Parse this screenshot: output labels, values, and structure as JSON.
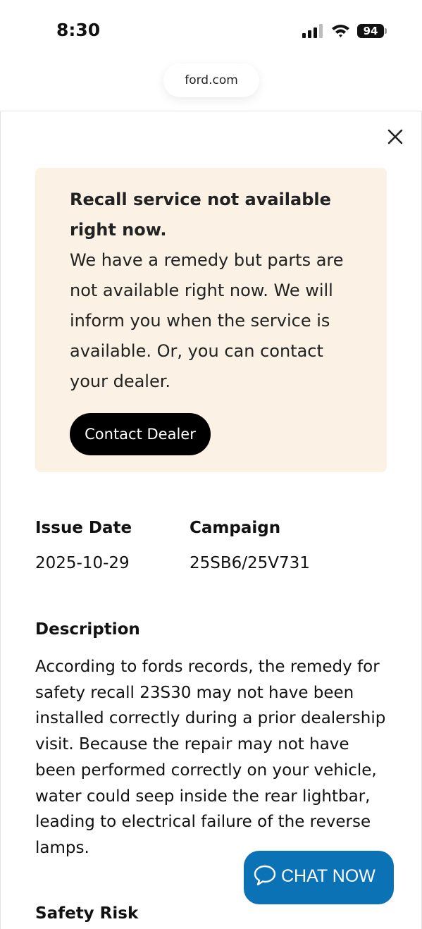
{
  "status_bar": {
    "time": "8:30",
    "battery": "94"
  },
  "browser": {
    "url": "ford.com"
  },
  "alert": {
    "title": "Recall service not available right now.",
    "body": "We have a remedy but parts are not available right now. We will inform you when the service is available. Or, you can contact your dealer.",
    "button_label": "Contact Dealer",
    "background_color": "#fbf1e4"
  },
  "details": {
    "issue_date_label": "Issue Date",
    "issue_date_value": "2025-10-29",
    "campaign_label": "Campaign",
    "campaign_value": "25SB6/25V731"
  },
  "description": {
    "heading": "Description",
    "body": "According to fords records, the remedy for safety recall 23S30 may not have been installed correctly during a prior dealership visit. Because the repair may not have been performed correctly on your vehicle, water could seep inside the rear lightbar, leading to electrical failure of the reverse lamps."
  },
  "safety_risk": {
    "heading": "Safety Risk"
  },
  "chat": {
    "label": "CHAT NOW",
    "color": "#0b72b5",
    "icon": "chat-bubble-icon"
  },
  "icons": {
    "close": "close-icon",
    "signal": "cellular-signal-icon",
    "wifi": "wifi-icon",
    "battery": "battery-icon"
  }
}
